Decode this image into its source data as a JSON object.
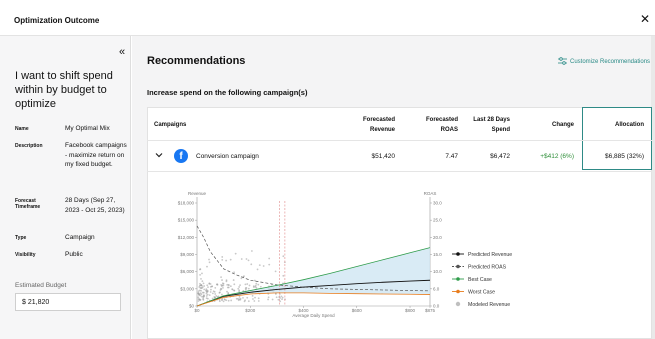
{
  "header": {
    "title": "Optimization Outcome"
  },
  "sidebar": {
    "goal": "I want to shift spend within by budget to optimize",
    "meta": [
      {
        "key": "Name",
        "value": "My Optimal Mix"
      },
      {
        "key": "Description",
        "value": "Facebook campaigns - maximize return on my fixed budget."
      },
      {
        "key": "Forecast Timeframe",
        "value": "28 Days (Sep 27, 2023 - Oct 25, 2023)"
      },
      {
        "key": "Type",
        "value": "Campaign"
      },
      {
        "key": "Visibility",
        "value": "Public"
      }
    ],
    "estimated_budget_label": "Estimated Budget",
    "estimated_budget_value": "$ 21,820"
  },
  "main": {
    "title": "Recommendations",
    "customize_label": "Customize Recommendations",
    "subtitle": "Increase spend on the following campaign(s)",
    "table": {
      "headers": [
        "Campaigns",
        "Forecasted Revenue",
        "Forecasted ROAS",
        "Last 28 Days Spend",
        "Change",
        "Allocation"
      ],
      "row": {
        "campaign": "Conversion campaign",
        "revenue": "$51,420",
        "roas": "7.47",
        "spend": "$6,472",
        "change": "+$412 (6%)",
        "allocation": "$6,885 (32%)",
        "change_color": "#2f8f3a"
      }
    }
  },
  "chart_data": {
    "type": "line",
    "xlabel": "Average Daily Spend",
    "ylabel_left": "Revenue",
    "ylabel_right": "ROAS",
    "x_ticks": [
      "$0",
      "$200",
      "$400",
      "$600",
      "$800",
      "$875"
    ],
    "y_left_ticks": [
      "$0",
      "$3,000",
      "$6,000",
      "$9,000",
      "$12,000",
      "$15,000",
      "$18,000"
    ],
    "y_right_ticks": [
      "0.0",
      "6.0",
      "10.0",
      "15.0",
      "20.0",
      "25.0",
      "30.0"
    ],
    "xlim": [
      0,
      875
    ],
    "ylim": [
      0,
      18000
    ],
    "series": [
      {
        "name": "Predicted Revenue",
        "color": "#111111",
        "x": [
          0,
          100,
          200,
          300,
          400,
          500,
          600,
          700,
          800,
          875
        ],
        "values": [
          0,
          1700,
          2400,
          2900,
          3300,
          3600,
          3900,
          4150,
          4350,
          4500
        ]
      },
      {
        "name": "Predicted ROAS",
        "color": "#555555",
        "x": [
          0,
          25,
          50,
          100,
          150,
          200,
          300,
          400,
          500,
          600,
          700,
          800,
          875
        ],
        "values": [
          14000,
          12000,
          9500,
          6500,
          5400,
          4500,
          3700,
          3300,
          3000,
          2900,
          2800,
          2700,
          2650
        ]
      },
      {
        "name": "Best Case",
        "color": "#2e9c4a",
        "x": [
          0,
          100,
          200,
          300,
          400,
          500,
          600,
          700,
          800,
          875
        ],
        "values": [
          0,
          1800,
          2700,
          3600,
          4600,
          5700,
          6900,
          8100,
          9300,
          10200
        ]
      },
      {
        "name": "Worst Case",
        "color": "#e87d1e",
        "x": [
          0,
          100,
          200,
          300,
          400,
          500,
          600,
          700,
          800,
          875
        ],
        "values": [
          0,
          1500,
          2100,
          2300,
          2300,
          2200,
          2150,
          2100,
          2050,
          2000
        ]
      },
      {
        "name": "Modeled Revenue",
        "color": "#bfbfbf"
      }
    ],
    "reference_lines_x": [
      310,
      330
    ],
    "legend": "right",
    "grid": false
  }
}
